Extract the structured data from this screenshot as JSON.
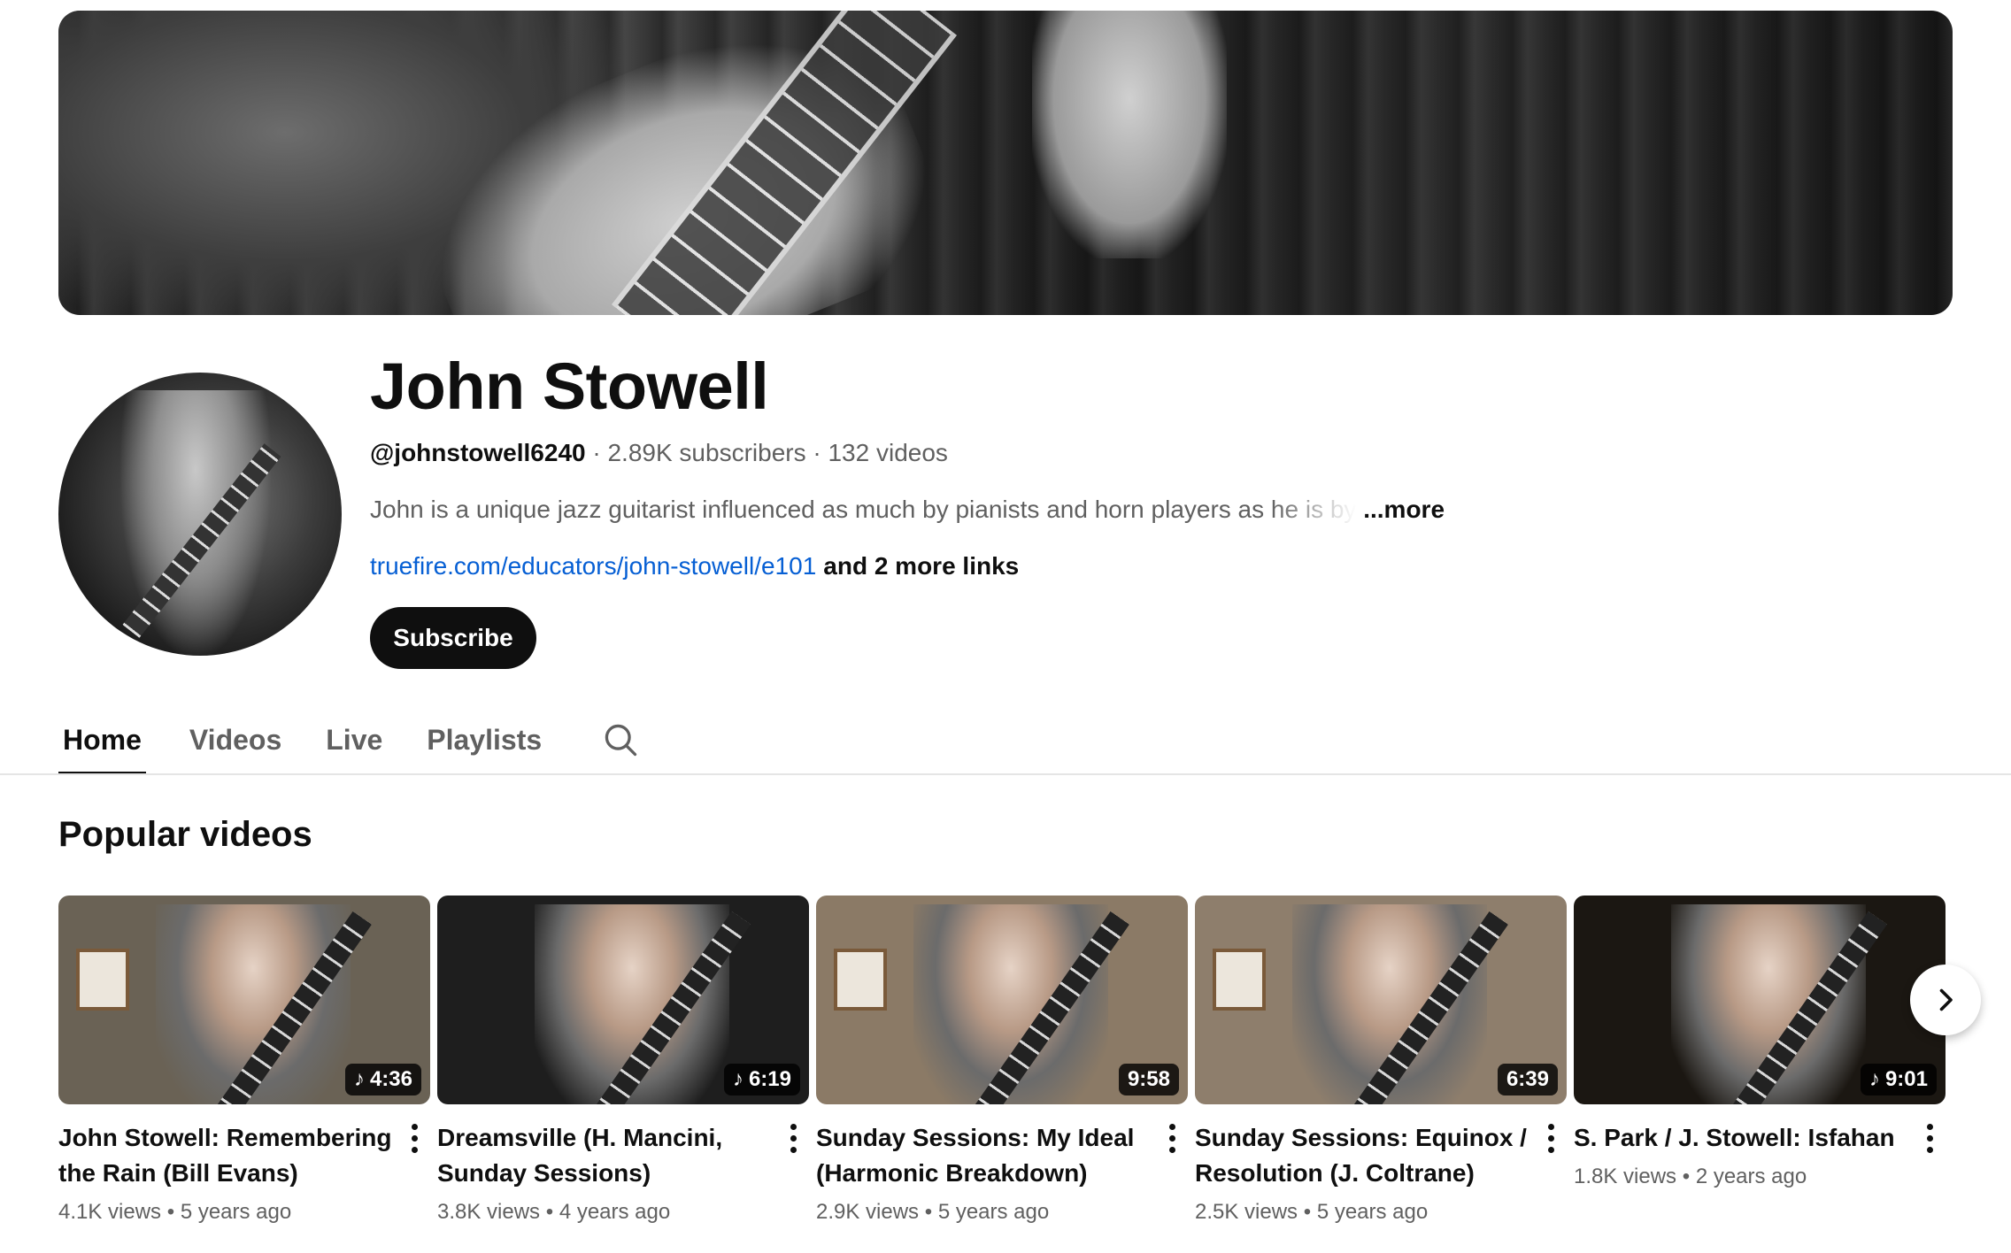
{
  "channel": {
    "name": "John Stowell",
    "handle": "@johnstowell6240",
    "subscribers": "2.89K subscribers",
    "videos_count": "132 videos",
    "separator": " · ",
    "description_visible": "John is a unique jazz guitarist influenced as much by pianists and horn players as ",
    "description_faded": "he is by",
    "more_label": "...more",
    "link": "truefire.com/educators/john-stowell/e101",
    "more_links": "and 2 more links",
    "subscribe_label": "Subscribe"
  },
  "tabs": [
    {
      "label": "Home",
      "active": true
    },
    {
      "label": "Videos",
      "active": false
    },
    {
      "label": "Live",
      "active": false
    },
    {
      "label": "Playlists",
      "active": false
    }
  ],
  "section": {
    "title": "Popular videos"
  },
  "videos": [
    {
      "title": "John Stowell: Remembering the Rain (Bill Evans)",
      "duration": "4:36",
      "music": true,
      "views": "4.1K views",
      "age": "5 years ago",
      "bg": "#6a6255"
    },
    {
      "title": "Dreamsville (H. Mancini, Sunday Sessions)",
      "duration": "6:19",
      "music": true,
      "views": "3.8K views",
      "age": "4 years ago",
      "bg": "#1e1e1e"
    },
    {
      "title": "Sunday Sessions: My Ideal (Harmonic Breakdown)",
      "duration": "9:58",
      "music": false,
      "views": "2.9K views",
      "age": "5 years ago",
      "bg": "#8b7a66"
    },
    {
      "title": "Sunday Sessions: Equinox / Resolution (J. Coltrane)",
      "duration": "6:39",
      "music": false,
      "views": "2.5K views",
      "age": "5 years ago",
      "bg": "#8e7e6c"
    },
    {
      "title": "S. Park / J. Stowell: Isfahan",
      "duration": "9:01",
      "music": true,
      "views": "1.8K views",
      "age": "2 years ago",
      "bg": "#1b1712"
    }
  ],
  "stats_separator": " • "
}
